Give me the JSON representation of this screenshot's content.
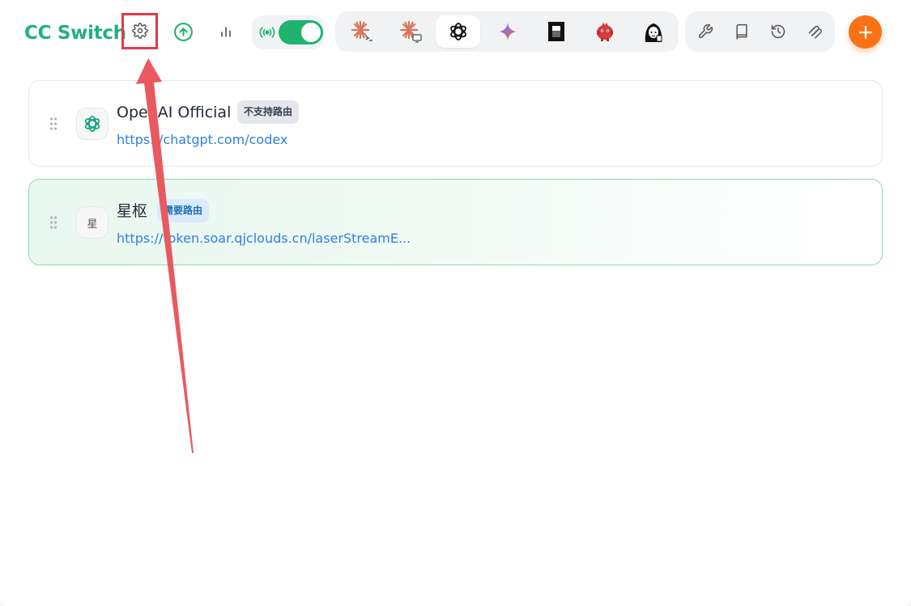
{
  "header": {
    "app_title": "CC Switch",
    "settings_icon": "gear-icon",
    "update_icon": "arrow-up-circle-icon",
    "stats_icon": "bar-chart-icon",
    "proxy_icon": "broadcast-signal-icon",
    "proxy_enabled": true,
    "apps": [
      {
        "icon": "claude-code-icon",
        "active": false
      },
      {
        "icon": "claude-desktop-icon",
        "active": false
      },
      {
        "icon": "openai-codex-icon",
        "active": true
      },
      {
        "icon": "gemini-icon",
        "active": false
      },
      {
        "icon": "opencode-icon",
        "active": false
      },
      {
        "icon": "red-mascot-icon",
        "active": false
      },
      {
        "icon": "character-avatar-icon",
        "active": false
      }
    ],
    "tools": [
      {
        "icon": "wrench-icon"
      },
      {
        "icon": "book-icon"
      },
      {
        "icon": "history-icon"
      },
      {
        "icon": "paperclip-icon"
      }
    ],
    "add_icon": "plus-icon"
  },
  "providers": [
    {
      "name": "OpenAI Official",
      "badge": "不支持路由",
      "url": "https://chatgpt.com/codex",
      "avatar_icon": "openai-logo-icon",
      "active": false
    },
    {
      "name": "星枢",
      "avatar_text": "星",
      "badge": "需要路由",
      "url": "https://token.soar.qjclouds.cn/laserStreamE...",
      "active": true
    }
  ],
  "colors": {
    "brand": "#22b07d",
    "toggle_on": "#1fb36e",
    "add_button": "#f97316",
    "link": "#2f7fe0",
    "annotation": "#e63946"
  }
}
